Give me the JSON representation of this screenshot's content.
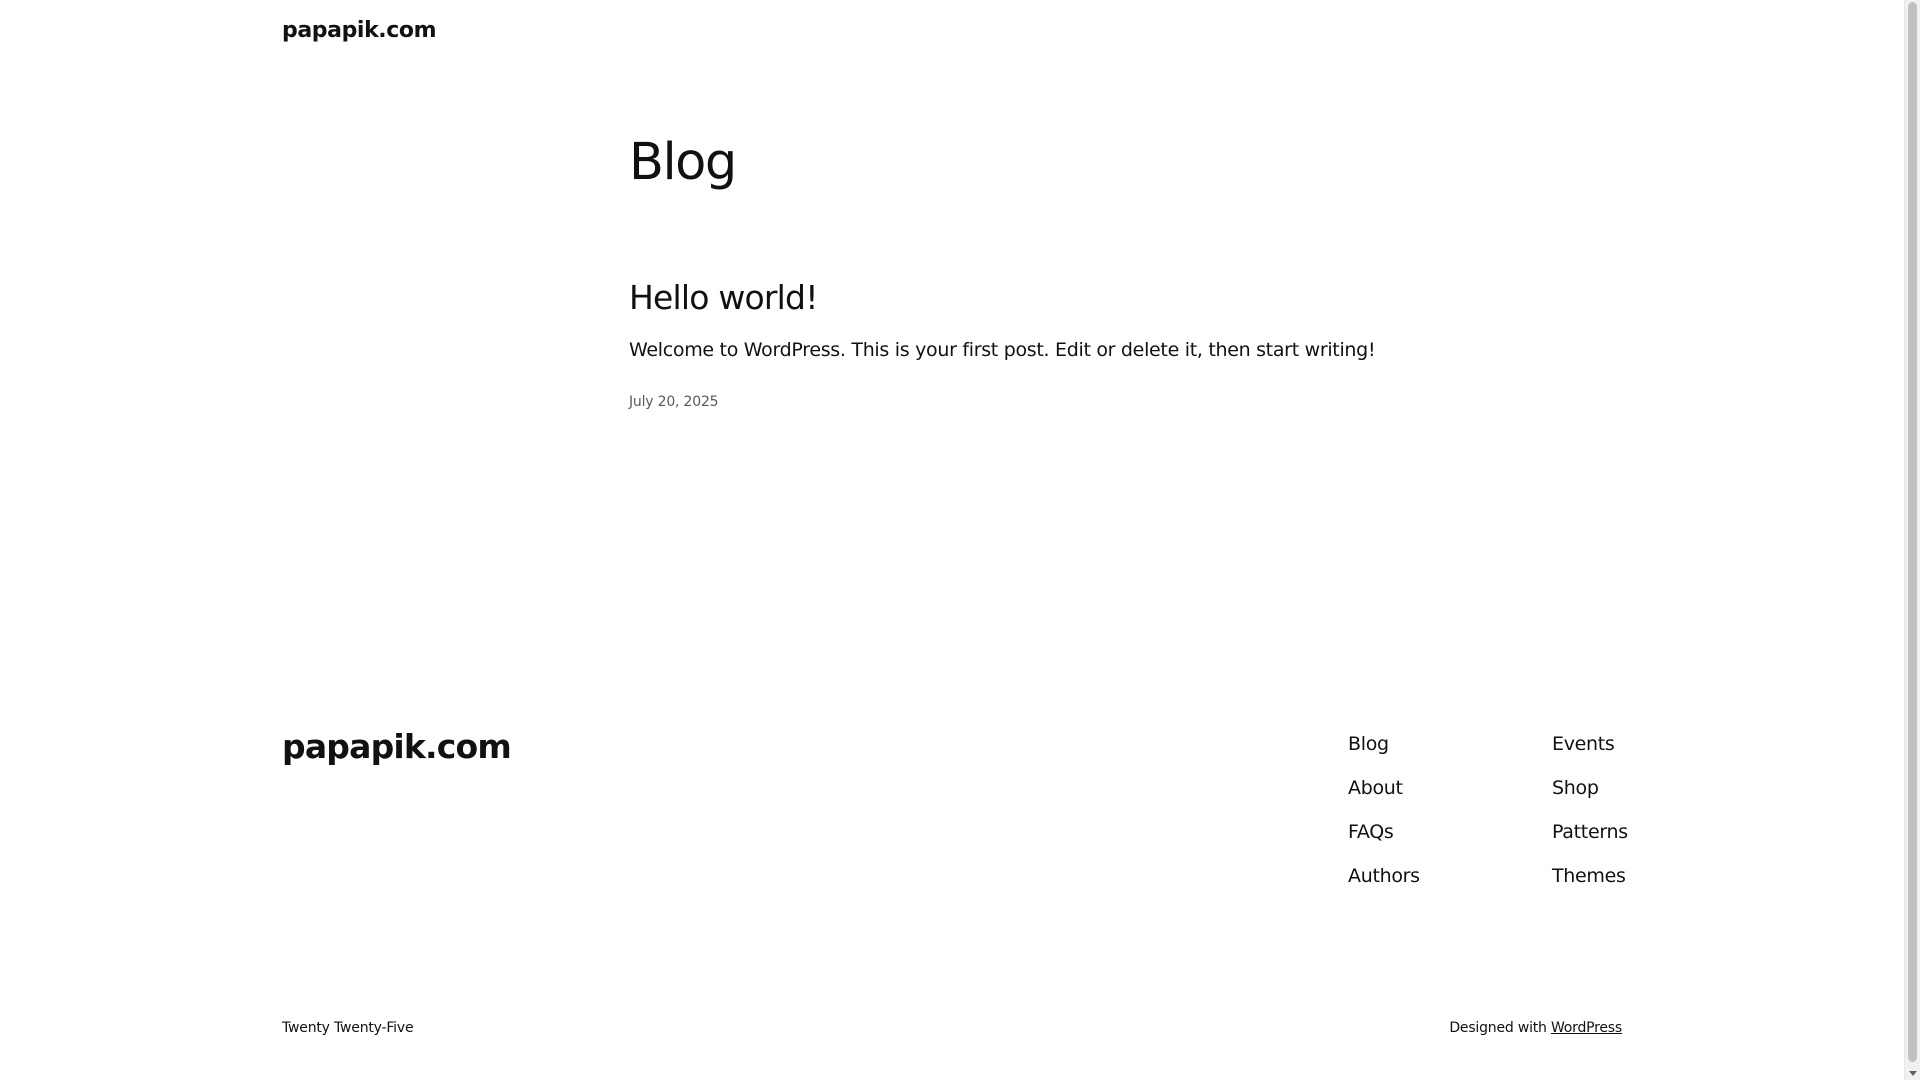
{
  "header": {
    "site_title": "papapik.com"
  },
  "main": {
    "page_title": "Blog",
    "posts": [
      {
        "title": "Hello world!",
        "excerpt": "Welcome to WordPress. This is your first post. Edit or delete it, then start writing!",
        "date": "July 20, 2025"
      }
    ]
  },
  "footer": {
    "site_title": "papapik.com",
    "nav_col_1": [
      "Blog",
      "About",
      "FAQs",
      "Authors"
    ],
    "nav_col_2": [
      "Events",
      "Shop",
      "Patterns",
      "Themes"
    ],
    "theme_name": "Twenty Twenty-Five",
    "designed_with_prefix": "Designed with ",
    "designed_with_link": "WordPress"
  },
  "colors": {
    "text": "#111111",
    "muted": "#5a5a5a",
    "background": "#ffffff"
  }
}
